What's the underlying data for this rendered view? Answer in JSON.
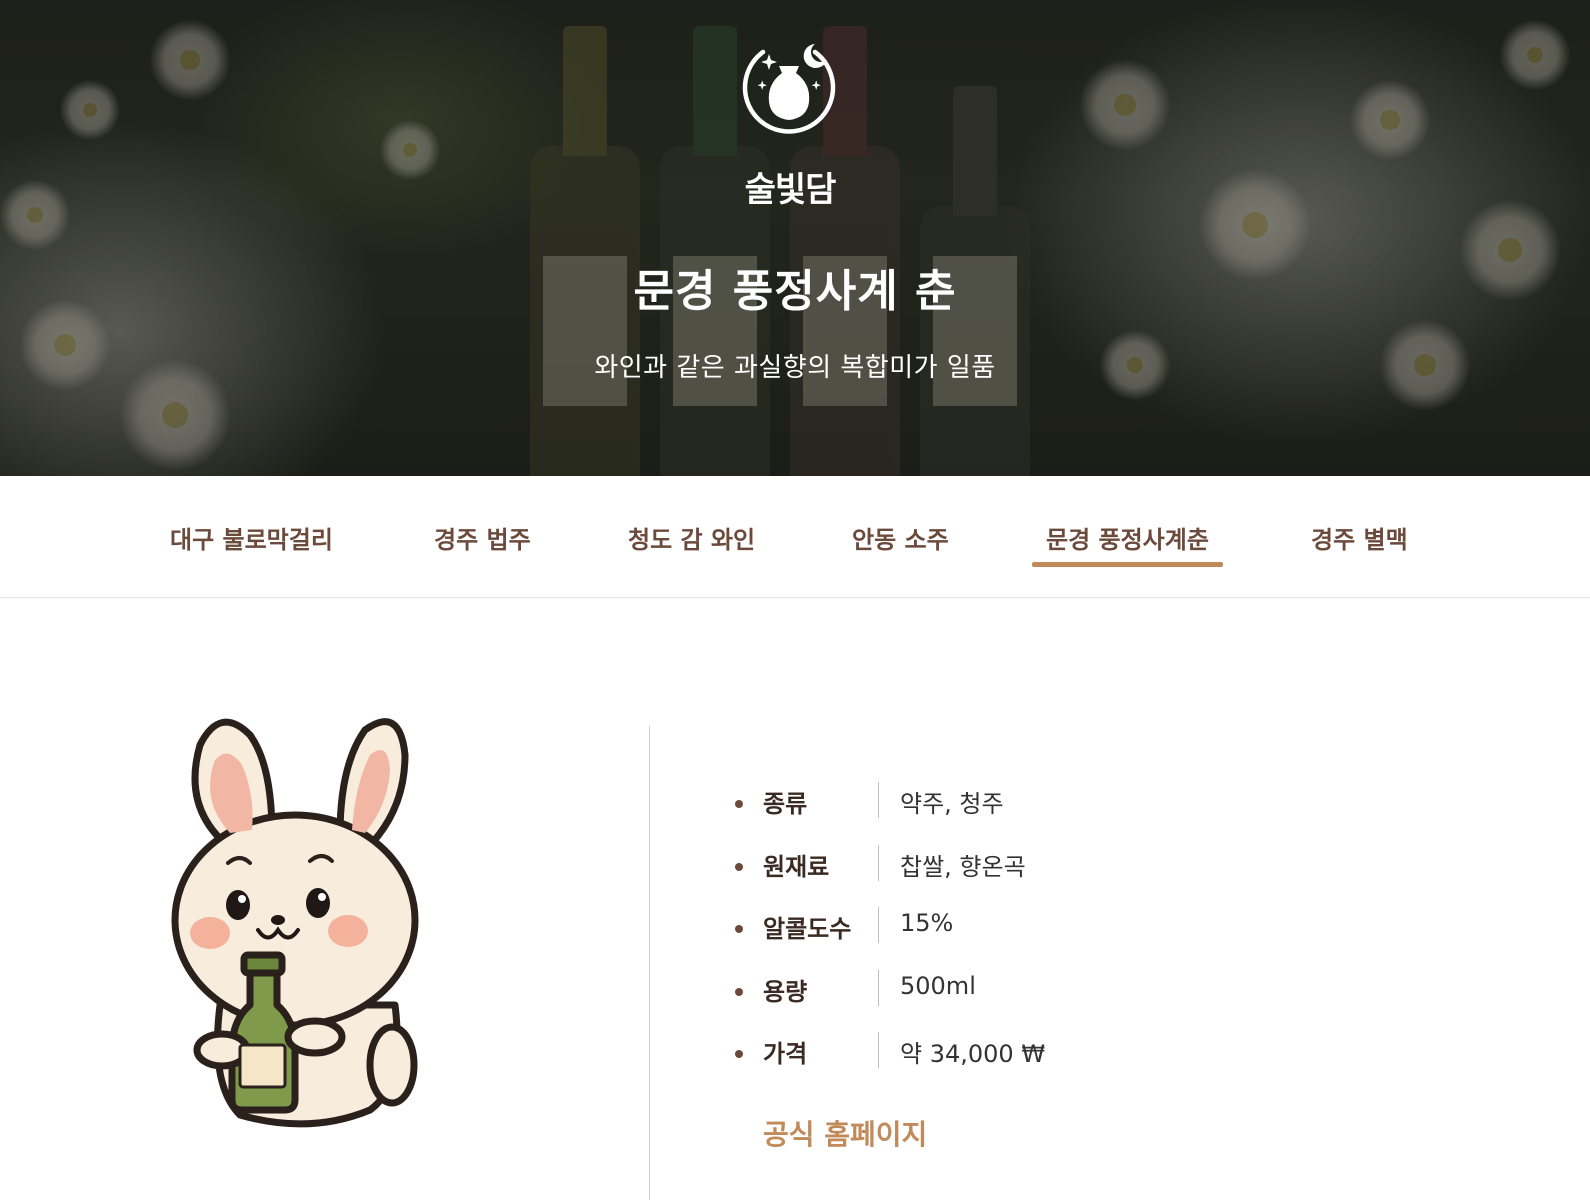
{
  "brand": {
    "name": "술빛담"
  },
  "hero": {
    "title": "문경 풍정사계 춘",
    "subtitle": "와인과 같은 과실향의 복합미가 일품"
  },
  "nav": {
    "items": [
      {
        "label": "대구 불로막걸리",
        "active": false
      },
      {
        "label": "경주 법주",
        "active": false
      },
      {
        "label": "청도 감 와인",
        "active": false
      },
      {
        "label": "안동 소주",
        "active": false
      },
      {
        "label": "문경 풍정사계춘",
        "active": true
      },
      {
        "label": "경주 별맥",
        "active": false
      }
    ]
  },
  "specs": [
    {
      "label": "종류",
      "value": "약주, 청주"
    },
    {
      "label": "원재료",
      "value": "찹쌀, 향온곡"
    },
    {
      "label": "알콜도수",
      "value": "15%"
    },
    {
      "label": "용량",
      "value": "500ml"
    },
    {
      "label": "가격",
      "value": "약 34,000 ₩"
    }
  ],
  "homepage_link": "공식 홈페이지",
  "colors": {
    "accent": "#c08a5a",
    "nav_text": "#6b4a3c",
    "label_text": "#3a2a22"
  },
  "icons": {
    "logo": "moon-sake-bottle-logo-icon",
    "illustration": "rabbit-holding-bottle-illustration"
  }
}
